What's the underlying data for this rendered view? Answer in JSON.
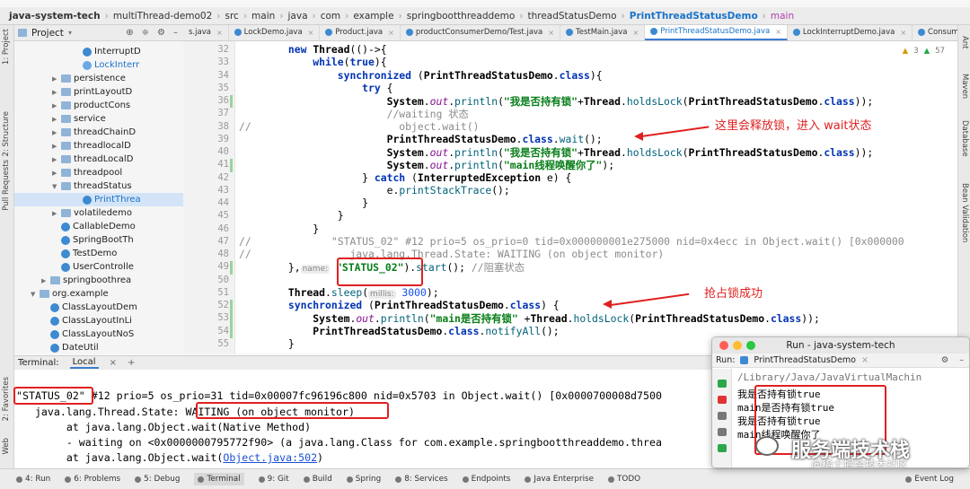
{
  "breadcrumb": [
    "java-system-tech",
    "multiThread-demo02",
    "src",
    "main",
    "java",
    "com",
    "example",
    "springbootthreaddemo",
    "threadStatusDemo",
    "PrintThreadStatusDemo",
    "main"
  ],
  "left_stripe": [
    "1: Project",
    "2: Structure",
    "Pull Requests",
    "2: Favorites",
    "Web"
  ],
  "right_stripe": [
    "Ant",
    "Maven",
    "Database",
    "Bean Validation"
  ],
  "project": {
    "title": "Project",
    "tree": [
      {
        "label": "InterruptD",
        "type": "class",
        "indent": 8
      },
      {
        "label": "LockInterr",
        "type": "lockclass",
        "indent": 8
      },
      {
        "label": "persistence",
        "type": "folder",
        "indent": 6
      },
      {
        "label": "printLayoutD",
        "type": "folder",
        "indent": 6
      },
      {
        "label": "productCons",
        "type": "folder",
        "indent": 6
      },
      {
        "label": "service",
        "type": "folder",
        "indent": 6
      },
      {
        "label": "threadChainD",
        "type": "folder",
        "indent": 6
      },
      {
        "label": "threadlocalD",
        "type": "folder",
        "indent": 6
      },
      {
        "label": "threadLocalD",
        "type": "folder",
        "indent": 6
      },
      {
        "label": "threadpool",
        "type": "folder",
        "indent": 6
      },
      {
        "label": "threadStatus",
        "type": "folder-open",
        "indent": 6
      },
      {
        "label": "PrintThrea",
        "type": "class-selected",
        "indent": 8
      },
      {
        "label": "volatiledemo",
        "type": "folder",
        "indent": 6
      },
      {
        "label": "CallableDemo",
        "type": "class",
        "indent": 6
      },
      {
        "label": "SpringBootTh",
        "type": "class",
        "indent": 6
      },
      {
        "label": "TestDemo",
        "type": "class",
        "indent": 6
      },
      {
        "label": "UserControlle",
        "type": "class",
        "indent": 6
      },
      {
        "label": "springboothrea",
        "type": "folder",
        "indent": 5
      },
      {
        "label": "org.example",
        "type": "folder-open",
        "indent": 4
      },
      {
        "label": "ClassLayoutDem",
        "type": "class",
        "indent": 5
      },
      {
        "label": "ClassLayoutInLi",
        "type": "class",
        "indent": 5
      },
      {
        "label": "ClassLayoutNoS",
        "type": "class",
        "indent": 5
      },
      {
        "label": "DateUtil",
        "type": "class",
        "indent": 5
      }
    ]
  },
  "tabs": [
    {
      "label": "s.java",
      "active": false
    },
    {
      "label": "LockDemo.java",
      "active": false
    },
    {
      "label": "Product.java",
      "active": false
    },
    {
      "label": "productConsumerDemo/Test.java",
      "active": false
    },
    {
      "label": "TestMain.java",
      "active": false
    },
    {
      "label": "PrintThreadStatusDemo.java",
      "active": true
    },
    {
      "label": "LockInterruptDemo.java",
      "active": false
    },
    {
      "label": "Consumer.java",
      "active": false
    }
  ],
  "inspection": {
    "warnings": "3",
    "weak": "57"
  },
  "editor": {
    "line_numbers": [
      "32",
      "33",
      "34",
      "35",
      "36",
      "37",
      "38",
      "39",
      "40",
      "41",
      "42",
      "43",
      "44",
      "45",
      "46",
      "47",
      "48",
      "49",
      "50",
      "51",
      "52",
      "53",
      "54",
      "55"
    ],
    "lines": [
      "        <k>new</k> <c>Thread</c>(()->{",
      "            <k>while</k>(<k>true</k>){",
      "                <k>synchronized</k> (<c>PrintThreadStatusDemo</c>.<k>class</k>){",
      "                    <k>try</k> {",
      "                        <c>System</c>.<f>out</f>.<m>println</m>(<s>\"我是否持有锁\"</s>+<c>Thread</c>.<m>holdsLock</m>(<c>PrintThreadStatusDemo</c>.<k>class</k>));",
      "                        <cm>//waiting 状态</cm>",
      "<cm>//                        object.wait()</cm>",
      "                        <c>PrintThreadStatusDemo</c>.<k>class</k>.<m>wait</m>();",
      "                        <c>System</c>.<f>out</f>.<m>println</m>(<s>\"我是否持有锁\"</s>+<c>Thread</c>.<m>holdsLock</m>(<c>PrintThreadStatusDemo</c>.<k>class</k>));",
      "                        <c>System</c>.<f>out</f>.<m>println</m>(<s>\"main线程唤醒你了\"</s>);",
      "                    } <k>catch</k> (<c>InterruptedException</c> e) {",
      "                        e.<m>printStackTrace</m>();",
      "                    }",
      "                }",
      "            }",
      "<cm>//             \"STATUS_02\" #12 prio=5 os_prio=0 tid=0x000000001e275000 nid=0x4ecc in Object.wait() [0x000000</cm>",
      "<cm>//                java.lang.Thread.State: WAITING (on object monitor)</cm>",
      "        },<h>name:</h> <s>\"STATUS_02\"</s>).<m>start</m>(); <cm>//阻塞状态</cm>",
      "",
      "        <c>Thread</c>.<m>sleep</m>(<h>millis:</h> <n>3000</n>);",
      "        <k>synchronized</k> (<c>PrintThreadStatusDemo</c>.<k>class</k>) {",
      "            <c>System</c>.<f>out</f>.<m>println</m>(<s>\"main是否持有锁\"</s> +<c>Thread</c>.<m>holdsLock</m>(<c>PrintThreadStatusDemo</c>.<k>class</k>));",
      "            <c>PrintThreadStatusDemo</c>.<k>class</k>.<m>notifyAll</m>();",
      "        }"
    ]
  },
  "annotations": {
    "release_lock": "这里会释放锁，进入 wait状态",
    "grab_lock": "抢占锁成功"
  },
  "terminal": {
    "title": "Terminal:",
    "tab": "Local",
    "lines": [
      "\"STATUS_02\" #12 prio=5 os_prio=31 tid=0x00007fc96196c800 nid=0x5703 in Object.wait() [0x0000700008d7500",
      "   java.lang.Thread.State: WAITING (on object monitor)",
      "        at java.lang.Object.wait(Native Method)",
      "        - waiting on <0x0000000795772f90> (a java.lang.Class for com.example.springbootthreaddemo.threa"
    ],
    "last_line_prefix": "        at java.lang.Object.wait(",
    "last_line_link": "Object.java:502",
    "last_line_suffix": ")"
  },
  "bottom_bar": [
    {
      "label": "4: Run",
      "active": false
    },
    {
      "label": "6: Problems",
      "active": false
    },
    {
      "label": "5: Debug",
      "active": false
    },
    {
      "label": "Terminal",
      "active": true
    },
    {
      "label": "9: Git",
      "active": false
    },
    {
      "label": "Build",
      "active": false
    },
    {
      "label": "Spring",
      "active": false
    },
    {
      "label": "8: Services",
      "active": false
    },
    {
      "label": "Endpoints",
      "active": false
    },
    {
      "label": "Java Enterprise",
      "active": false
    },
    {
      "label": "TODO",
      "active": false
    },
    {
      "label": "Event Log",
      "active": false
    }
  ],
  "run_window": {
    "title": "Run - java-system-tech",
    "run_label": "Run:",
    "config": "PrintThreadStatusDemo",
    "output": [
      "/Library/Java/JavaVirtualMachin",
      "我是否持有锁true",
      "main是否持有锁true",
      "我是否持有锁true",
      "main线程唤醒你了"
    ]
  },
  "watermark": {
    "main": "服务端技术栈",
    "sub": "@稀土掘金技术社区"
  },
  "colors": {
    "annotation": "#e02020",
    "accent": "#3d7cd0",
    "link": "#1a73c9"
  }
}
